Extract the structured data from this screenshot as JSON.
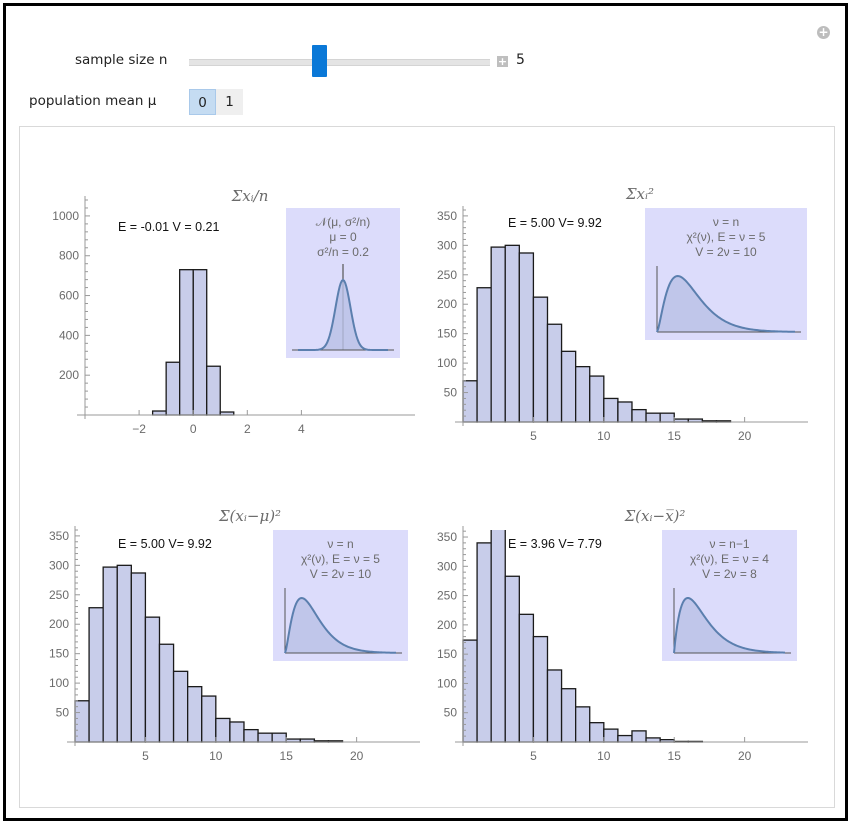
{
  "controls": {
    "sample_size": {
      "label": "sample size n",
      "value": "5",
      "slider_fraction": 0.43,
      "plus_label": "+"
    },
    "population_mean": {
      "label": "population mean μ",
      "options": [
        "0",
        "1"
      ],
      "selected": "0"
    },
    "corner_button_label": "+"
  },
  "colors": {
    "bar_fill": "#c8cdea",
    "bar_stroke": "#1a1a1a",
    "inset_bg": "#dcdcfb",
    "curve": "#5b7fae",
    "curve_fill": "#b9c1e6",
    "slider_thumb": "#0a78d7",
    "tick_text": "#6b6b6b"
  },
  "chart_data": [
    {
      "type": "bar",
      "title": "Σxᵢ/n",
      "stats": "E = -0.01  V =  0.21",
      "bin_edges": [
        -1.5,
        -1,
        -0.5,
        0,
        0.5,
        1,
        1.5
      ],
      "values": [
        20,
        265,
        730,
        730,
        245,
        15
      ],
      "xlim": [
        -4,
        8.2
      ],
      "ylim": [
        0,
        1080
      ],
      "xticks": [
        -2,
        0,
        2,
        4
      ],
      "yticks": [
        200,
        400,
        600,
        800,
        1000
      ],
      "mean_line": 0,
      "inset": {
        "kind": "normal",
        "lines": [
          "𝒩(μ, σ²/n)",
          "μ = 0",
          "σ²/n = 0.2"
        ]
      }
    },
    {
      "type": "bar",
      "title": "Σxᵢ²",
      "stats": "E =  5.00  V=  9.92",
      "bin_edges": [
        0,
        1,
        2,
        3,
        4,
        5,
        6,
        7,
        8,
        9,
        10,
        11,
        12,
        13,
        14,
        15,
        16,
        17,
        18,
        19
      ],
      "values": [
        70,
        228,
        297,
        300,
        287,
        212,
        166,
        120,
        94,
        78,
        40,
        34,
        21,
        15,
        15,
        5,
        5,
        2,
        2
      ],
      "xlim": [
        0,
        24.5
      ],
      "ylim": [
        0,
        360
      ],
      "xticks": [
        5,
        10,
        15,
        20
      ],
      "yticks": [
        50,
        100,
        150,
        200,
        250,
        300,
        350
      ],
      "inset": {
        "kind": "chisq",
        "dof": 5,
        "lines": [
          "ν = n",
          "χ²(ν), E = ν = 5",
          "V = 2ν = 10"
        ]
      }
    },
    {
      "type": "bar",
      "title": "Σ(xᵢ−μ)²",
      "stats": "E =  5.00  V=  9.92",
      "bin_edges": [
        0,
        1,
        2,
        3,
        4,
        5,
        6,
        7,
        8,
        9,
        10,
        11,
        12,
        13,
        14,
        15,
        16,
        17,
        18,
        19
      ],
      "values": [
        70,
        228,
        297,
        300,
        287,
        212,
        166,
        120,
        94,
        78,
        40,
        34,
        21,
        15,
        15,
        5,
        5,
        2,
        2
      ],
      "xlim": [
        0,
        24.5
      ],
      "ylim": [
        0,
        360
      ],
      "xticks": [
        5,
        10,
        15,
        20
      ],
      "yticks": [
        50,
        100,
        150,
        200,
        250,
        300,
        350
      ],
      "inset": {
        "kind": "chisq",
        "dof": 5,
        "lines": [
          "ν = n",
          "χ²(ν), E = ν = 5",
          "V = 2ν = 10"
        ]
      }
    },
    {
      "type": "bar",
      "title": "Σ(xᵢ−x̅)²",
      "stats": "E =  3.96  V=  7.79",
      "bin_edges": [
        0,
        1,
        2,
        3,
        4,
        5,
        6,
        7,
        8,
        9,
        10,
        11,
        12,
        13,
        14,
        15,
        16,
        17
      ],
      "values": [
        174,
        340,
        375,
        283,
        218,
        180,
        123,
        91,
        60,
        33,
        22,
        11,
        19,
        7,
        4,
        1,
        1
      ],
      "xlim": [
        0,
        24.5
      ],
      "ylim": [
        0,
        362
      ],
      "xticks": [
        5,
        10,
        15,
        20
      ],
      "yticks": [
        50,
        100,
        150,
        200,
        250,
        300,
        350
      ],
      "inset": {
        "kind": "chisq",
        "dof": 4,
        "lines": [
          "ν = n−1",
          "χ²(ν), E = ν = 4",
          "V = 2ν = 8"
        ]
      }
    }
  ]
}
